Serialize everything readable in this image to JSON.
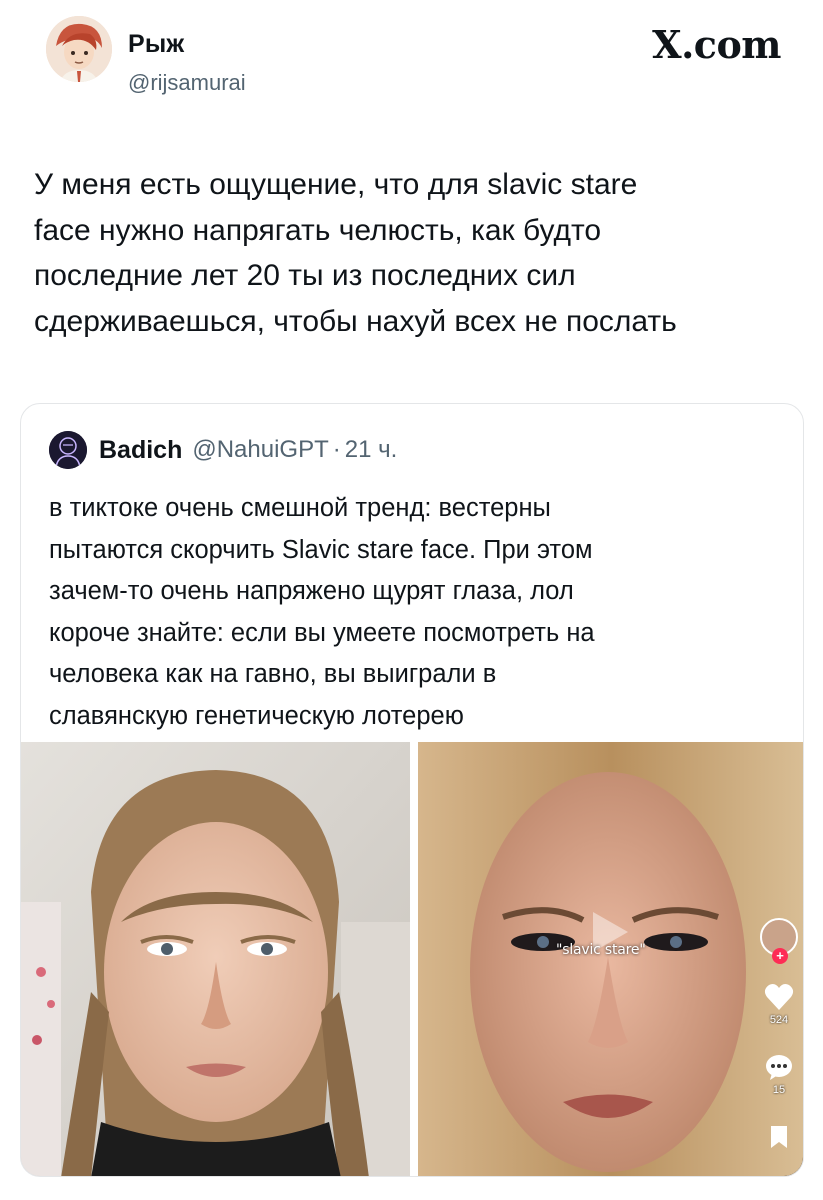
{
  "header": {
    "display_name": "Рыж",
    "handle": "@rijsamurai",
    "brand": "X.com"
  },
  "tweet": {
    "lines": [
      "У меня есть ощущение, что для slavic stare",
      "face нужно напрягать челюсть, как будто",
      "последние лет 20 ты из последних сил",
      "сдерживаешься, чтобы нахуй всех не послать"
    ]
  },
  "quote": {
    "name": "Badich",
    "handle": "@NahuiGPT",
    "separator": "·",
    "time": "21 ч.",
    "lines": [
      "в тиктоке очень смешной тренд: вестерны",
      "пытаются скорчить Slavic stare face. При этом",
      "зачем-то очень напряжено щурят глаза, лол",
      "короче знайте: если вы умеете посмотреть на",
      "человека как на гавно, вы выиграли в",
      "славянскую генетическую лотерею"
    ]
  },
  "media": {
    "caption": "\"slavic stare\"",
    "likes": "524",
    "comments": "15",
    "icons": [
      "heart-icon",
      "comment-icon",
      "bookmark-icon",
      "plus-icon"
    ]
  },
  "colors": {
    "text": "#0f1419",
    "secondary": "#536471",
    "border": "#e4e6e8",
    "tiktok_red": "#fe2c55"
  }
}
